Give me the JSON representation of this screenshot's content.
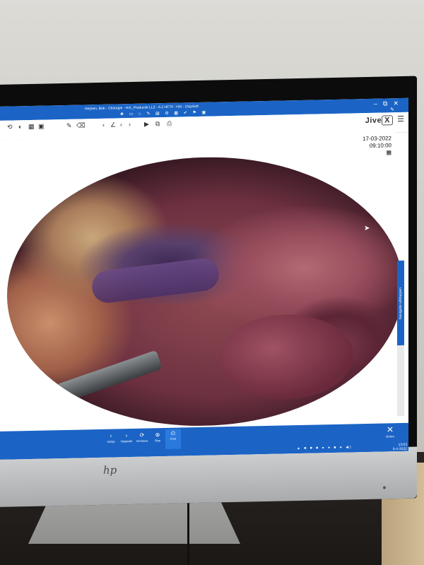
{
  "window": {
    "title": "Heijnen, Bob - Chirurgie - HiX_Productie LLZ - 6.2 HF74 - HiX - ChipSoft",
    "controls": [
      "–",
      "⧉",
      "✕"
    ]
  },
  "viewer": {
    "brand": "Jive",
    "brand_mark": "X",
    "date": "17-03-2022",
    "time": "09:10:00"
  },
  "side_panel": {
    "label": "Navigatie uitklappen"
  },
  "actions": [
    {
      "label": "Vorige",
      "icon": "chevron-left-icon"
    },
    {
      "label": "Volgende",
      "icon": "chevron-right-icon"
    },
    {
      "label": "Vernieuw",
      "icon": "refresh-icon"
    },
    {
      "label": "Stop",
      "icon": "stop-icon"
    },
    {
      "label": "Print",
      "icon": "print-icon"
    }
  ],
  "close_action": {
    "label": "Sluiten"
  },
  "taskbar": {
    "clock_time": "13:03",
    "clock_date": "5-4-2022"
  }
}
